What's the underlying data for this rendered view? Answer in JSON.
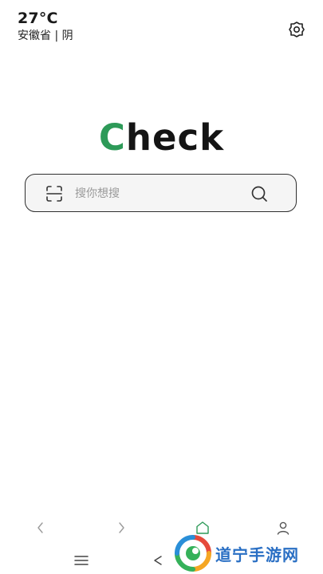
{
  "weather": {
    "temperature": "27°C",
    "location": "安徽省 | 阴"
  },
  "logo": {
    "first_letter": "C",
    "rest": "heck"
  },
  "search": {
    "placeholder": "搜你想搜"
  },
  "icons": {
    "settings": "gear-icon",
    "scan": "scan-icon",
    "search": "search-icon",
    "back": "chevron-left-icon",
    "forward": "chevron-right-icon",
    "home": "home-icon",
    "profile": "person-icon",
    "menu": "menu-icon",
    "system_back": "back-icon"
  },
  "colors": {
    "accent": "#2d9a58",
    "text": "#141414",
    "watermark": "#2a6fc4"
  },
  "watermark": {
    "text": "道宁手游网"
  }
}
